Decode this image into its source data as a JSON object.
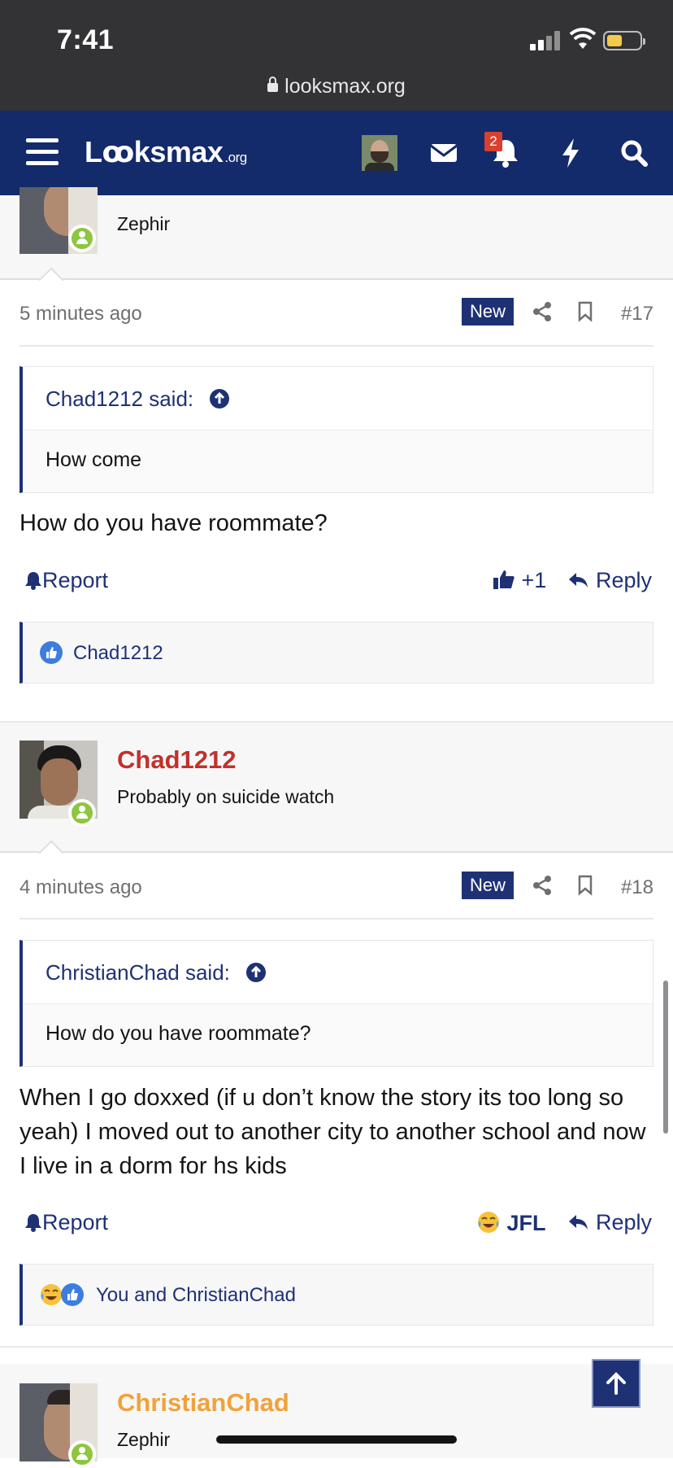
{
  "status_bar": {
    "time": "7:41",
    "url": "looksmax.org"
  },
  "nav": {
    "logo": "Lꝏksmax",
    "logo_suffix": ".org",
    "alerts_badge": "2",
    "icons": [
      "menu-icon",
      "avatar",
      "mail-icon",
      "bell-icon",
      "lightning-icon",
      "search-icon"
    ]
  },
  "posts": [
    {
      "author_title": "Zephir",
      "time": "5 minutes ago",
      "new_label": "New",
      "number": "#17",
      "quote_author": "Chad1212 said:",
      "quote_text": "How come",
      "body": "How do you have roommate?",
      "report": "Report",
      "reaction": "+1",
      "reply": "Reply",
      "reactions_text": "Chad1212"
    },
    {
      "author": "Chad1212",
      "author_color": "#c0322b",
      "author_title": "Probably on suicide watch",
      "time": "4 minutes ago",
      "new_label": "New",
      "number": "#18",
      "quote_author": "ChristianChad said:",
      "quote_text": "How do you have roommate?",
      "body": "When I go doxxed (if u don’t know the story its too long so yeah) I moved out to another city to another school and now I live in a dorm for hs kids",
      "report": "Report",
      "reaction": "JFL",
      "reply": "Reply",
      "reactions_text": "You and ChristianChad"
    },
    {
      "author": "ChristianChad",
      "author_color": "#f0a23a",
      "author_title": "Zephir"
    }
  ],
  "colors": {
    "nav": "#132a6b",
    "accent": "#1e3175",
    "online": "#8dc63f"
  }
}
